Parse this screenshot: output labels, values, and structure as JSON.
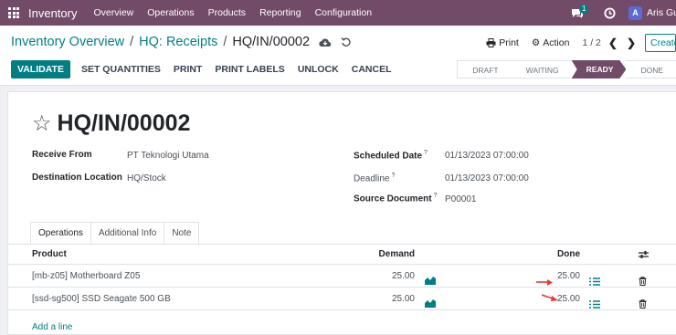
{
  "topbar": {
    "app_name": "Inventory",
    "menu": [
      "Overview",
      "Operations",
      "Products",
      "Reporting",
      "Configuration"
    ],
    "chat_count": "1",
    "avatar_letter": "A",
    "user_name": "Aris Gunawan"
  },
  "breadcrumb": {
    "part1": "Inventory Overview",
    "part2": "HQ: Receipts",
    "current": "HQ/IN/00002",
    "sep": "/"
  },
  "actions": {
    "print": "Print",
    "action": "Action",
    "pager": "1 / 2",
    "create": "Create"
  },
  "buttons": {
    "validate": "Validate",
    "set_quantities": "Set Quantities",
    "print": "Print",
    "print_labels": "Print Labels",
    "unlock": "Unlock",
    "cancel": "Cancel"
  },
  "statusbar": {
    "steps": [
      "Draft",
      "Waiting",
      "Ready",
      "Done"
    ],
    "active": "Ready"
  },
  "record": {
    "title": "HQ/IN/00002",
    "receive_from_label": "Receive From",
    "receive_from": "PT Teknologi Utama",
    "destination_label": "Destination Location",
    "destination": "HQ/Stock",
    "scheduled_label": "Scheduled Date",
    "scheduled": "01/13/2023 07:00:00",
    "deadline_label": "Deadline",
    "deadline": "01/13/2023 07:00:00",
    "source_label": "Source Document",
    "source": "P00001",
    "help_mark": "?"
  },
  "tabs": [
    "Operations",
    "Additional Info",
    "Note"
  ],
  "table": {
    "headers": {
      "product": "Product",
      "demand": "Demand",
      "done": "Done"
    },
    "rows": [
      {
        "product": "[mb-z05] Motherboard Z05",
        "demand": "25.00",
        "done": "25.00"
      },
      {
        "product": "[ssd-sg500] SSD Seagate 500 GB",
        "demand": "25.00",
        "done": "25.00"
      }
    ],
    "add_line": "Add a line"
  },
  "colors": {
    "brand": "#714b67",
    "accent": "#017e84",
    "annotation": "#e53935"
  }
}
